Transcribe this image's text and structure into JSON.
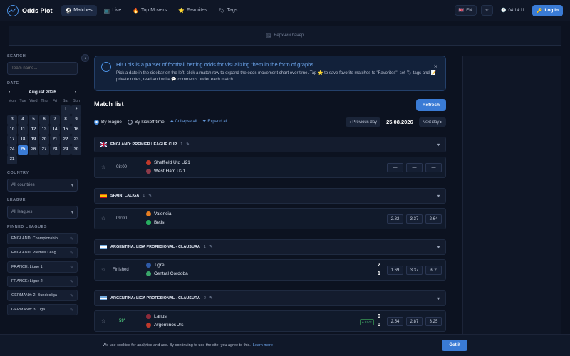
{
  "header": {
    "app_name": "Odds Plot",
    "nav": [
      {
        "label": "Matches",
        "icon": "⚽",
        "active": true
      },
      {
        "label": "Live",
        "icon": "📺"
      },
      {
        "label": "Top Movers",
        "icon": "🔥"
      },
      {
        "label": "Favorites",
        "icon": "⭐"
      },
      {
        "label": "Tags",
        "icon": "🏷"
      }
    ],
    "lang": "EN",
    "lang_flag": "🇬🇧",
    "theme_icon": "☀",
    "clock": "04:14:11",
    "login": "Log in"
  },
  "banner": {
    "text": "Верхний банер",
    "icon": "🖼"
  },
  "sidebar": {
    "search_label": "SEARCH",
    "search_placeholder": "Team name...",
    "date_label": "DATE",
    "month": "August 2026",
    "prev": "‹",
    "next": "›",
    "weekdays": [
      "Mon",
      "Tue",
      "Wed",
      "Thu",
      "Fri",
      "Sat",
      "Sun"
    ],
    "days": [
      "1",
      "2",
      "3",
      "4",
      "5",
      "6",
      "7",
      "8",
      "9",
      "10",
      "11",
      "12",
      "13",
      "14",
      "15",
      "16",
      "17",
      "18",
      "19",
      "20",
      "21",
      "22",
      "23",
      "24",
      "25",
      "26",
      "27",
      "28",
      "29",
      "30",
      "31"
    ],
    "selected_day": "25",
    "country_label": "COUNTRY",
    "country_value": "All countries",
    "league_label": "LEAGUE",
    "league_value": "All leagues",
    "pinned_label": "PINNED LEAGUES",
    "pinned": [
      "ENGLAND: Championship",
      "ENGLAND: Premier Leag...",
      "FRANCE: Ligue 1",
      "FRANCE: Ligue 2",
      "GERMANY: 2. Bundesliga",
      "GERMANY: 3. Liga"
    ]
  },
  "info": {
    "title": "Hi! This is a parser of football betting odds for visualizing them in the form of graphs.",
    "text": "Pick a date in the sidebar on the left, click a match row to expand the odds movement chart over time. Tap ⭐ to save favorite matches to \"Favorites\", set 🏷 tags and 📝 private notes, read and write 💬 comments under each match."
  },
  "list": {
    "title": "Match list",
    "refresh": "Refresh",
    "by_league": "By league",
    "by_kickoff": "By kickoff time",
    "collapse_all": "Collapse all",
    "expand_all": "Expand all",
    "prev_day": "◂ Previous day",
    "date": "25.08.2026",
    "next_day": "Next day ▸"
  },
  "leagues": [
    {
      "name": "ENGLAND: PREMIER LEAGUE CUP",
      "count": "1",
      "flag": "gb"
    },
    {
      "name": "SPAIN: LALIGA",
      "count": "1",
      "flag": "es"
    },
    {
      "name": "ARGENTINA: LIGA PROFESIONAL - CLAUSURA",
      "count": "1",
      "flag": "ar"
    },
    {
      "name": "ARGENTINA: LIGA PROFESIONAL - CLAUSURA",
      "count": "2",
      "flag": "ar"
    }
  ],
  "matches": [
    {
      "time": "08:00",
      "home": "Sheffield Utd U21",
      "away": "West Ham U21",
      "odds": [
        "—",
        "—",
        "—"
      ]
    },
    {
      "time": "09:00",
      "home": "Valencia",
      "away": "Betis",
      "odds": [
        "2.82",
        "3.37",
        "2.64"
      ]
    },
    {
      "time": "Finished",
      "home": "Tigre",
      "away": "Central Cordoba",
      "home_score": "2",
      "away_score": "1",
      "odds": [
        "1.69",
        "3.37",
        "6.2"
      ]
    },
    {
      "time": "59'",
      "home": "Lanus",
      "away": "Argentinos Jrs",
      "home_score": "0",
      "away_score": "0",
      "live": "● LIVE",
      "odds": [
        "2.54",
        "2.87",
        "3.25"
      ]
    }
  ],
  "cookie": {
    "text": "We use cookies for analytics and ads. By continuing to use the site, you agree to this.",
    "link": "Learn more",
    "button": "Got it"
  }
}
